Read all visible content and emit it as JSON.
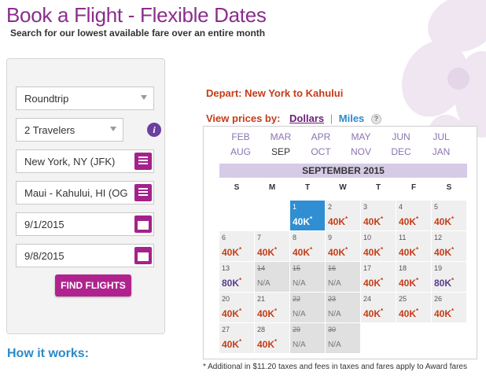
{
  "page": {
    "title": "Book a Flight - Flexible Dates",
    "subtitle": "Search for our lowest available fare over an entire month"
  },
  "form": {
    "trip_type": "Roundtrip",
    "travelers": "2 Travelers",
    "origin": "New York, NY (JFK)",
    "destination": "Maui - Kahului, HI (OG",
    "depart_date": "9/1/2015",
    "return_date": "9/8/2015",
    "find_button": "FIND FLIGHTS"
  },
  "how_it_works": "How it works:",
  "results": {
    "depart_text": "Depart: New York to Kahului",
    "view_prices_label": "View prices by:",
    "dollars_label": "Dollars",
    "separator": "|",
    "miles_label": "Miles",
    "help_icon_text": "?"
  },
  "months": [
    "FEB",
    "MAR",
    "APR",
    "MAY",
    "JUN",
    "JUL",
    "AUG",
    "SEP",
    "OCT",
    "NOV",
    "DEC",
    "JAN"
  ],
  "active_month": "SEP",
  "calendar": {
    "title": "SEPTEMBER 2015",
    "weekdays": [
      "S",
      "M",
      "T",
      "W",
      "T",
      "F",
      "S"
    ],
    "days": [
      {
        "day": "1",
        "price": "40K",
        "star": "*",
        "status": "selected"
      },
      {
        "day": "2",
        "price": "40K",
        "star": "*",
        "status": "normal"
      },
      {
        "day": "3",
        "price": "40K",
        "star": "*",
        "status": "normal"
      },
      {
        "day": "4",
        "price": "40K",
        "star": "*",
        "status": "normal"
      },
      {
        "day": "5",
        "price": "40K",
        "star": "*",
        "status": "normal"
      },
      {
        "day": "6",
        "price": "40K",
        "star": "*",
        "status": "normal"
      },
      {
        "day": "7",
        "price": "40K",
        "star": "*",
        "status": "normal"
      },
      {
        "day": "8",
        "price": "40K",
        "star": "*",
        "status": "normal"
      },
      {
        "day": "9",
        "price": "40K",
        "star": "*",
        "status": "normal"
      },
      {
        "day": "10",
        "price": "40K",
        "star": "*",
        "status": "normal"
      },
      {
        "day": "11",
        "price": "40K",
        "star": "*",
        "status": "normal"
      },
      {
        "day": "12",
        "price": "40K",
        "star": "*",
        "status": "normal"
      },
      {
        "day": "13",
        "price": "80K",
        "star": "*",
        "status": "purple"
      },
      {
        "day": "14",
        "price": "N/A",
        "star": "",
        "status": "na"
      },
      {
        "day": "15",
        "price": "N/A",
        "star": "",
        "status": "na"
      },
      {
        "day": "16",
        "price": "N/A",
        "star": "",
        "status": "na"
      },
      {
        "day": "17",
        "price": "40K",
        "star": "*",
        "status": "normal"
      },
      {
        "day": "18",
        "price": "40K",
        "star": "*",
        "status": "normal"
      },
      {
        "day": "19",
        "price": "80K",
        "star": "*",
        "status": "purple"
      },
      {
        "day": "20",
        "price": "40K",
        "star": "*",
        "status": "normal"
      },
      {
        "day": "21",
        "price": "40K",
        "star": "*",
        "status": "normal"
      },
      {
        "day": "22",
        "price": "N/A",
        "star": "",
        "status": "na"
      },
      {
        "day": "23",
        "price": "N/A",
        "star": "",
        "status": "na"
      },
      {
        "day": "24",
        "price": "40K",
        "star": "*",
        "status": "normal"
      },
      {
        "day": "25",
        "price": "40K",
        "star": "*",
        "status": "normal"
      },
      {
        "day": "26",
        "price": "40K",
        "star": "*",
        "status": "normal"
      },
      {
        "day": "27",
        "price": "40K",
        "star": "*",
        "status": "normal"
      },
      {
        "day": "28",
        "price": "40K",
        "star": "*",
        "status": "normal"
      },
      {
        "day": "29",
        "price": "N/A",
        "star": "",
        "status": "na"
      },
      {
        "day": "30",
        "price": "N/A",
        "star": "",
        "status": "na"
      }
    ],
    "first_weekday_index": 2
  },
  "footnote": "* Additional in $11.20 taxes and fees in taxes and fares apply to Award fares",
  "colors": {
    "brand_purple": "#8a2e8c",
    "button_magenta": "#b0238f",
    "price_red": "#c43c18",
    "link_blue": "#2a8ac9",
    "selected_blue": "#2f8fd2"
  },
  "icons": {
    "trip_type_arrow": "chevron-down-icon",
    "travelers_arrow": "chevron-down-icon",
    "travelers_info": "info-icon",
    "origin_picker": "list-icon",
    "destination_picker": "list-icon",
    "depart_picker": "calendar-icon",
    "return_picker": "calendar-icon",
    "miles_help": "help-icon"
  }
}
